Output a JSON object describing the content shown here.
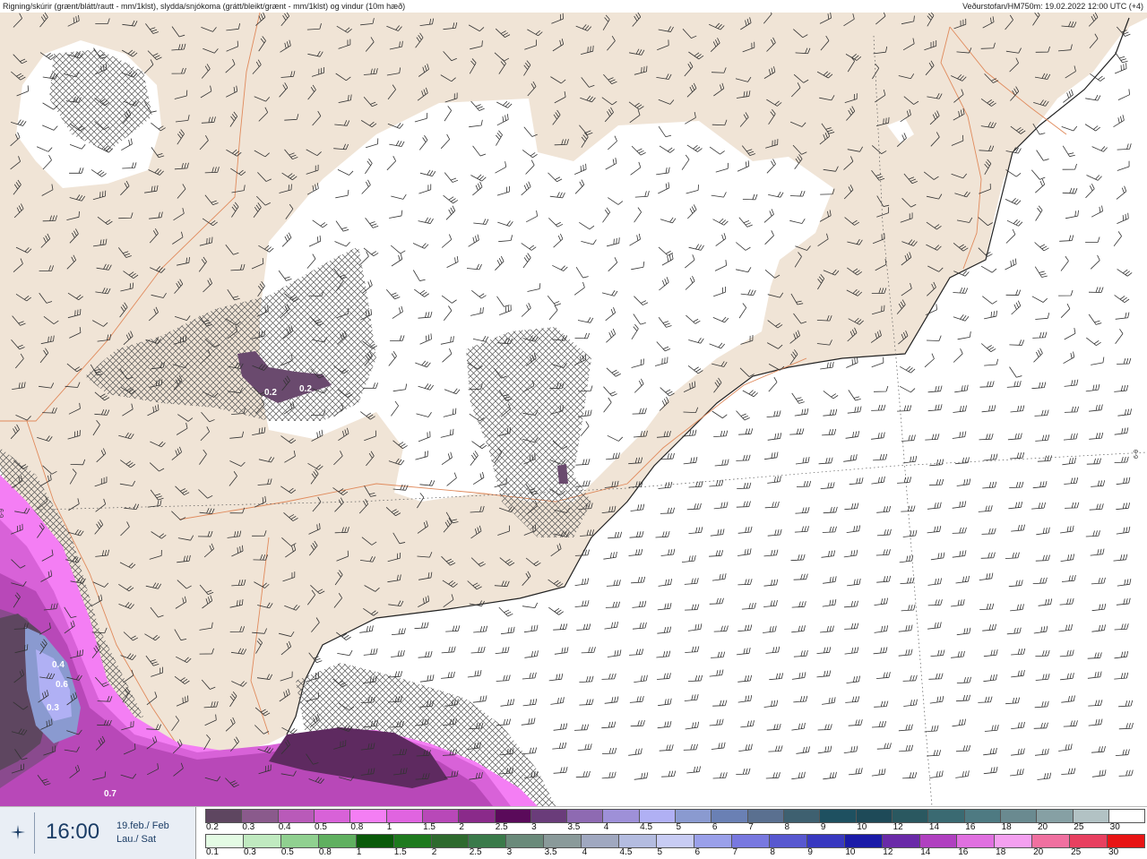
{
  "header": {
    "left": "Rigning/skúrir (grænt/blátt/rautt - mm/1klst), slydda/snjókoma (grátt/bleikt/grænt - mm/1klst) og vindur (10m hæð)",
    "right": "Veðurstofan/HM750m: 19.02.2022 12:00 UTC (+4)"
  },
  "time": {
    "clock": "16:00",
    "date_line1": "19.feb./ Feb",
    "date_line2": "Lau./ Sat",
    "icon": "wind-compass-icon"
  },
  "map": {
    "value_labels": [
      "0.2",
      "0.2",
      "0.4",
      "0.6",
      "0.3",
      "0.7"
    ],
    "grid_label": "6-9",
    "colors": {
      "land": "#f0e4d6",
      "ice": "#ffffff",
      "sea": "#ffffff",
      "roads": "#e08a5c",
      "coast": "#222222",
      "hatch": "#555555"
    }
  },
  "legend_snow": {
    "labels": [
      "0.2",
      "0.3",
      "0.4",
      "0.5",
      "0.8",
      "1",
      "1.5",
      "2",
      "2.5",
      "3",
      "3.5",
      "4",
      "4.5",
      "5",
      "6",
      "7",
      "8",
      "9",
      "10",
      "12",
      "14",
      "16",
      "18",
      "20",
      "25",
      "30"
    ],
    "colors": [
      "#5e4660",
      "#8a5a8c",
      "#b95ab9",
      "#d862d8",
      "#f47ef4",
      "#e064e0",
      "#b848b8",
      "#8a2a8a",
      "#5a0a5a",
      "#6a3c7a",
      "#8e6ab2",
      "#9e90d8",
      "#b0b0f4",
      "#8a9ad0",
      "#6a80b4",
      "#5a7090",
      "#3e6070",
      "#1e5060",
      "#1e4a58",
      "#2a5860",
      "#3a6a72",
      "#4e7a82",
      "#6a8a90",
      "#86a0a4",
      "#b2c2c4",
      "#ffffff"
    ]
  },
  "legend_rain": {
    "labels": [
      "0.1",
      "0.3",
      "0.5",
      "0.8",
      "1",
      "1.5",
      "2",
      "2.5",
      "3",
      "3.5",
      "4",
      "4.5",
      "5",
      "6",
      "7",
      "8",
      "9",
      "10",
      "12",
      "14",
      "16",
      "18",
      "20",
      "25",
      "30"
    ],
    "colors": [
      "#e4fbe4",
      "#c0eac0",
      "#90d090",
      "#60b060",
      "#0a5a0a",
      "#1e7a1e",
      "#2e6a2e",
      "#3a7a4a",
      "#6a8a7a",
      "#8a9a9a",
      "#a0a8c0",
      "#b4bce0",
      "#c8ccf4",
      "#9aa0ea",
      "#7878e0",
      "#5858d0",
      "#3838c0",
      "#1a1aa8",
      "#6a2aa8",
      "#b040c0",
      "#e070e0",
      "#f4a0f0",
      "#f070a0",
      "#e84060",
      "#e81414"
    ]
  }
}
